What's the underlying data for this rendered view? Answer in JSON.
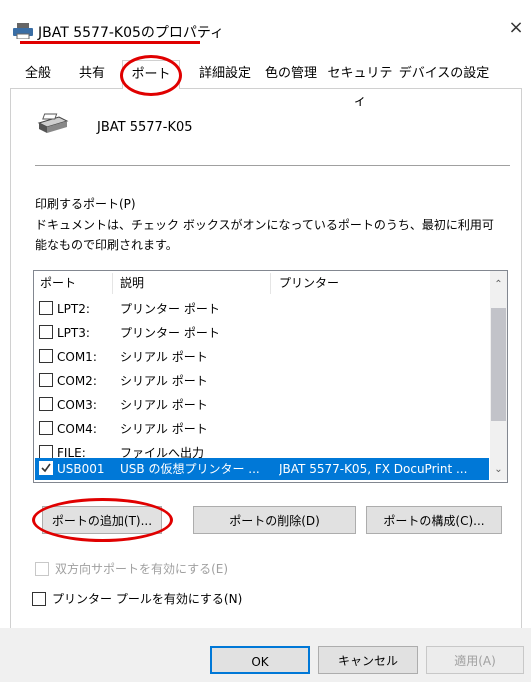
{
  "window": {
    "title": "JBAT 5577-K05のプロパティ",
    "close_glyph": "×"
  },
  "tabs": [
    "全般",
    "共有",
    "ポート",
    "詳細設定",
    "色の管理",
    "セキュリティ",
    "デバイスの設定"
  ],
  "printer": {
    "name": "JBAT 5577-K05"
  },
  "ports_section": {
    "label": "印刷するポート(P)",
    "description": "ドキュメントは、チェック ボックスがオンになっているポートのうち、最初に利用可能なもので印刷されます。"
  },
  "port_list": {
    "columns": [
      "ポート",
      "説明",
      "プリンター"
    ],
    "rows": [
      {
        "port": "LPT2:",
        "desc": "プリンター ポート",
        "printer": "",
        "checked": false,
        "selected": false
      },
      {
        "port": "LPT3:",
        "desc": "プリンター ポート",
        "printer": "",
        "checked": false,
        "selected": false
      },
      {
        "port": "COM1:",
        "desc": "シリアル ポート",
        "printer": "",
        "checked": false,
        "selected": false
      },
      {
        "port": "COM2:",
        "desc": "シリアル ポート",
        "printer": "",
        "checked": false,
        "selected": false
      },
      {
        "port": "COM3:",
        "desc": "シリアル ポート",
        "printer": "",
        "checked": false,
        "selected": false
      },
      {
        "port": "COM4:",
        "desc": "シリアル ポート",
        "printer": "",
        "checked": false,
        "selected": false
      },
      {
        "port": "FILE:",
        "desc": "ファイルへ出力",
        "printer": "",
        "checked": false,
        "selected": false
      },
      {
        "port": "USB001",
        "desc": "USB の仮想プリンター ...",
        "printer": "JBAT 5577-K05, FX DocuPrint ...",
        "checked": true,
        "selected": true
      }
    ]
  },
  "port_buttons": {
    "add": "ポートの追加(T)...",
    "delete": "ポートの削除(D)",
    "configure": "ポートの構成(C)..."
  },
  "options": {
    "bidirectional": {
      "label": "双方向サポートを有効にする(E)",
      "enabled": false,
      "checked": false
    },
    "pooling": {
      "label": "プリンター プールを有効にする(N)",
      "enabled": true,
      "checked": false
    }
  },
  "footer": {
    "ok": "OK",
    "cancel": "キャンセル",
    "apply": "適用(A)"
  },
  "colors": {
    "highlight": "#e00000",
    "selection": "#0078d7"
  }
}
